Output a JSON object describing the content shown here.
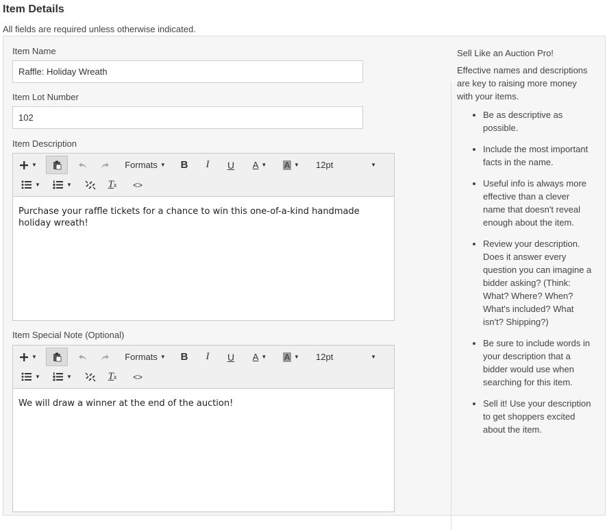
{
  "header": {
    "title": "Item Details",
    "required_note": "All fields are required unless otherwise indicated."
  },
  "form": {
    "item_name": {
      "label": "Item Name",
      "value": "Raffle: Holiday Wreath"
    },
    "lot_number": {
      "label": "Item Lot Number",
      "value": "102"
    },
    "description": {
      "label": "Item Description",
      "text": "Purchase your raffle tickets for a chance to win this one-of-a-kind handmade holiday wreath!"
    },
    "special_note": {
      "label": "Item Special Note (Optional)",
      "text": "We will draw a winner at the end of the auction!"
    }
  },
  "toolbar": {
    "formats_label": "Formats",
    "font_size": "12pt",
    "bold": "B",
    "italic": "I",
    "underline": "U",
    "text_color": "A",
    "bg_color": "A",
    "source": "<>"
  },
  "tips": {
    "title": "Sell Like an Auction Pro!",
    "intro": "Effective names and descriptions are key to raising more money with your items.",
    "items": [
      "Be as descriptive as possible.",
      "Include the most important facts in the name.",
      "Useful info is always more effective than a clever name that doesn't reveal enough about the item.",
      "Review your description. Does it answer every question you can imagine a bidder asking? (Think: What? Where? When? What's included? What isn't? Shipping?)",
      "Be sure to include words in your description that a bidder would use when searching for this item.",
      "Sell it! Use your description to get shoppers excited about the item."
    ]
  },
  "colors": {
    "panel_bg": "#f6f6f6",
    "toolbar_bg": "#f0f0f0",
    "border": "#c8c8c8"
  }
}
